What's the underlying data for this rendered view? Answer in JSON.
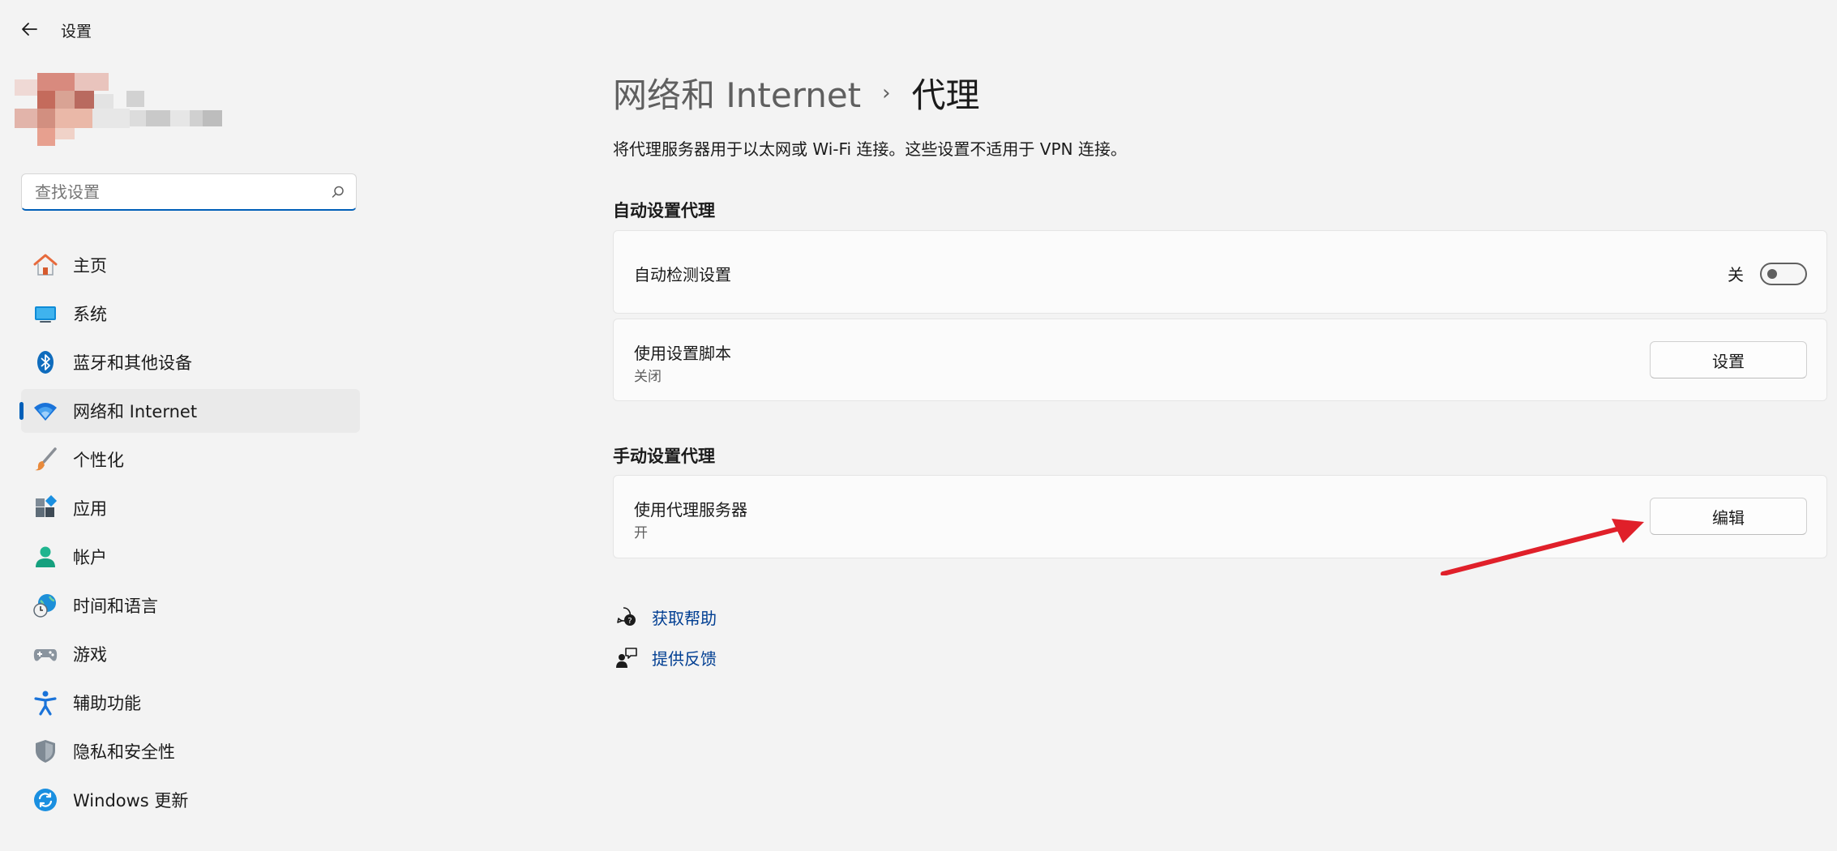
{
  "window": {
    "title": "设置"
  },
  "search": {
    "placeholder": "查找设置"
  },
  "nav": {
    "items": [
      {
        "label": "主页"
      },
      {
        "label": "系统"
      },
      {
        "label": "蓝牙和其他设备"
      },
      {
        "label": "网络和 Internet",
        "selected": true
      },
      {
        "label": "个性化"
      },
      {
        "label": "应用"
      },
      {
        "label": "帐户"
      },
      {
        "label": "时间和语言"
      },
      {
        "label": "游戏"
      },
      {
        "label": "辅助功能"
      },
      {
        "label": "隐私和安全性"
      },
      {
        "label": "Windows 更新"
      }
    ]
  },
  "header": {
    "parent": "网络和 Internet",
    "separator": "›",
    "current": "代理",
    "description": "将代理服务器用于以太网或 Wi-Fi 连接。这些设置不适用于 VPN 连接。"
  },
  "auto_section": {
    "label": "自动设置代理",
    "detect": {
      "title": "自动检测设置",
      "state": "关",
      "on": false
    },
    "script": {
      "title": "使用设置脚本",
      "subtitle": "关闭",
      "button": "设置"
    }
  },
  "manual_section": {
    "label": "手动设置代理",
    "proxy": {
      "title": "使用代理服务器",
      "subtitle": "开",
      "button": "编辑"
    }
  },
  "links": {
    "help": "获取帮助",
    "feedback": "提供反馈"
  },
  "colors": {
    "accent": "#005fb8",
    "link": "#003e92",
    "annotation_arrow": "#e0202a"
  }
}
